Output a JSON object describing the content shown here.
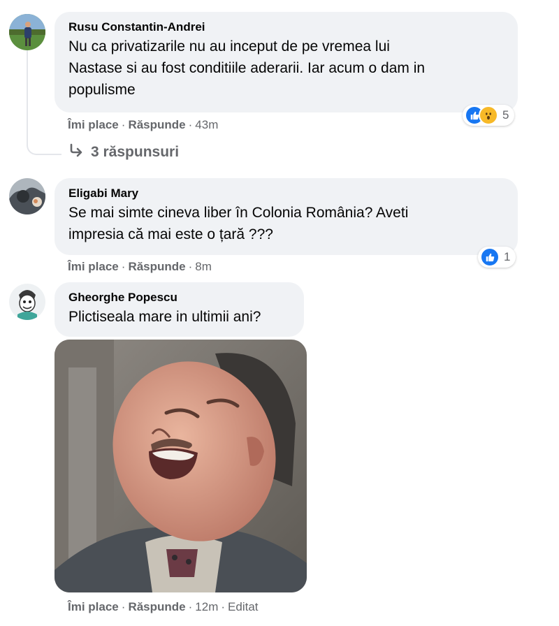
{
  "comments": [
    {
      "author": "Rusu Constantin-Andrei",
      "text_lines": [
        "Nu ca privatizarile nu au inceput de pe vremea lui",
        "Nastase si au fost conditiile aderarii. Iar acum o dam in",
        "populisme"
      ],
      "like": "Îmi place",
      "reply": "Răspunde",
      "time": "43m",
      "reaction_count": "5",
      "reaction_icons": [
        "like-icon",
        "wow-icon"
      ],
      "replies_label": "3 răspunsuri"
    },
    {
      "author": "Eligabi Mary",
      "text_lines": [
        "Se mai simte cineva liber în Colonia România? Aveti",
        "impresia că mai este o țară ???"
      ],
      "like": "Îmi place",
      "reply": "Răspunde",
      "time": "8m",
      "reaction_count": "1",
      "reaction_icons": [
        "like-icon"
      ]
    },
    {
      "author": "Gheorghe Popescu",
      "text_lines": [
        "Plictiseala mare in ultimii ani?"
      ],
      "like": "Îmi place",
      "reply": "Răspunde",
      "time": "12m",
      "edited": "Editat",
      "attachment": "laughing-man-gif"
    }
  ],
  "colors": {
    "bubble": "#f0f2f5",
    "meta_text": "#65676b",
    "like_blue": "#1877f2",
    "wow_yellow": "#f7b928"
  }
}
